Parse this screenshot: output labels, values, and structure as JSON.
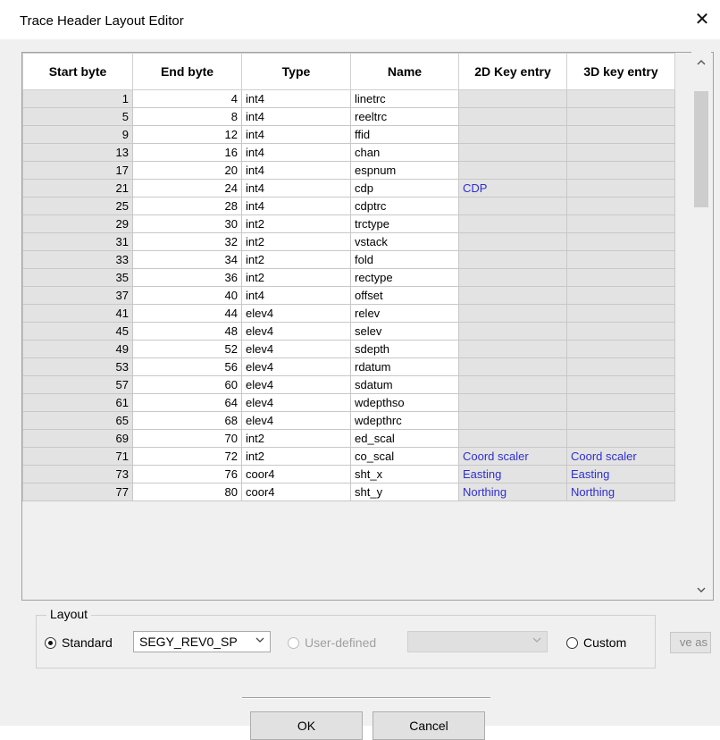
{
  "window": {
    "title": "Trace Header Layout Editor"
  },
  "grid": {
    "columns": [
      "Start byte",
      "End byte",
      "Type",
      "Name",
      "2D Key entry",
      "3D key entry"
    ],
    "rows": [
      {
        "start": "1",
        "end": "4",
        "type": "int4",
        "name": "linetrc",
        "key2d": "",
        "key3d": ""
      },
      {
        "start": "5",
        "end": "8",
        "type": "int4",
        "name": "reeltrc",
        "key2d": "",
        "key3d": ""
      },
      {
        "start": "9",
        "end": "12",
        "type": "int4",
        "name": "ffid",
        "key2d": "",
        "key3d": ""
      },
      {
        "start": "13",
        "end": "16",
        "type": "int4",
        "name": "chan",
        "key2d": "",
        "key3d": ""
      },
      {
        "start": "17",
        "end": "20",
        "type": "int4",
        "name": "espnum",
        "key2d": "",
        "key3d": ""
      },
      {
        "start": "21",
        "end": "24",
        "type": "int4",
        "name": "cdp",
        "key2d": "CDP",
        "key3d": ""
      },
      {
        "start": "25",
        "end": "28",
        "type": "int4",
        "name": "cdptrc",
        "key2d": "",
        "key3d": ""
      },
      {
        "start": "29",
        "end": "30",
        "type": "int2",
        "name": "trctype",
        "key2d": "",
        "key3d": ""
      },
      {
        "start": "31",
        "end": "32",
        "type": "int2",
        "name": "vstack",
        "key2d": "",
        "key3d": ""
      },
      {
        "start": "33",
        "end": "34",
        "type": "int2",
        "name": "fold",
        "key2d": "",
        "key3d": ""
      },
      {
        "start": "35",
        "end": "36",
        "type": "int2",
        "name": "rectype",
        "key2d": "",
        "key3d": ""
      },
      {
        "start": "37",
        "end": "40",
        "type": "int4",
        "name": "offset",
        "key2d": "",
        "key3d": ""
      },
      {
        "start": "41",
        "end": "44",
        "type": "elev4",
        "name": "relev",
        "key2d": "",
        "key3d": ""
      },
      {
        "start": "45",
        "end": "48",
        "type": "elev4",
        "name": "selev",
        "key2d": "",
        "key3d": ""
      },
      {
        "start": "49",
        "end": "52",
        "type": "elev4",
        "name": "sdepth",
        "key2d": "",
        "key3d": ""
      },
      {
        "start": "53",
        "end": "56",
        "type": "elev4",
        "name": "rdatum",
        "key2d": "",
        "key3d": ""
      },
      {
        "start": "57",
        "end": "60",
        "type": "elev4",
        "name": "sdatum",
        "key2d": "",
        "key3d": ""
      },
      {
        "start": "61",
        "end": "64",
        "type": "elev4",
        "name": "wdepthso",
        "key2d": "",
        "key3d": ""
      },
      {
        "start": "65",
        "end": "68",
        "type": "elev4",
        "name": "wdepthrc",
        "key2d": "",
        "key3d": ""
      },
      {
        "start": "69",
        "end": "70",
        "type": "int2",
        "name": "ed_scal",
        "key2d": "",
        "key3d": ""
      },
      {
        "start": "71",
        "end": "72",
        "type": "int2",
        "name": "co_scal",
        "key2d": "Coord scaler",
        "key3d": "Coord scaler"
      },
      {
        "start": "73",
        "end": "76",
        "type": "coor4",
        "name": "sht_x",
        "key2d": "Easting",
        "key3d": "Easting"
      },
      {
        "start": "77",
        "end": "80",
        "type": "coor4",
        "name": "sht_y",
        "key2d": "Northing",
        "key3d": "Northing"
      }
    ]
  },
  "layout": {
    "legend": "Layout",
    "standard_label": "Standard",
    "standard_value": "SEGY_REV0_SP",
    "user_defined_label": "User-defined",
    "custom_label": "Custom",
    "save_as_label": "ve as"
  },
  "buttons": {
    "ok": "OK",
    "cancel": "Cancel"
  },
  "icons": {
    "close": "close-icon",
    "dropdown": "chevron-down-icon",
    "scroll_up": "chevron-up-icon",
    "scroll_down": "chevron-down-icon"
  },
  "colors": {
    "key_text": "#2f2fd0",
    "readonly_cell": "#e3e3e3"
  }
}
